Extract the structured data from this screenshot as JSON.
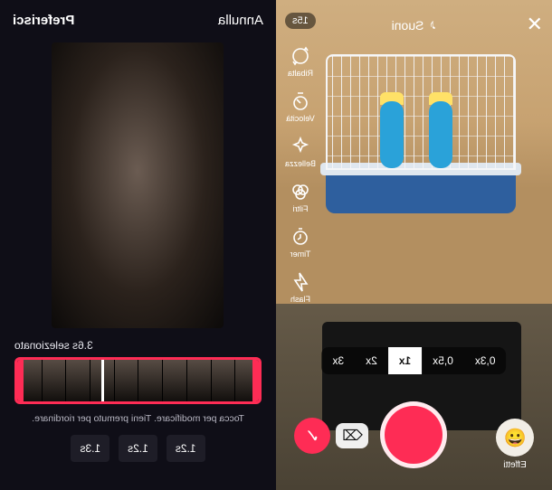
{
  "camera": {
    "close": "✕",
    "sounds_label": "Suoni",
    "duration_label": "15s",
    "side_tools": [
      {
        "id": "flip",
        "label": "Ribalta"
      },
      {
        "id": "speed",
        "label": "Velocità"
      },
      {
        "id": "beauty",
        "label": "Bellezza"
      },
      {
        "id": "filters",
        "label": "Filtri"
      },
      {
        "id": "timer",
        "label": "Timer"
      },
      {
        "id": "flash",
        "label": "Flash"
      }
    ],
    "speeds": [
      "0,3x",
      "0,5x",
      "1x",
      "2x",
      "3x"
    ],
    "speed_selected": "1x",
    "effects_label": "Effetti",
    "effects_emoji": "😀",
    "delete_glyph": "⌫",
    "next_glyph": "✓"
  },
  "trim": {
    "cancel": "Annulla",
    "done": "Preferisci",
    "selection_label": "3.6s selezionato",
    "hint": "Tocca per modificare. Tieni premuto per riordinare.",
    "thumb_count": 10,
    "quick_durations": [
      "1.2s",
      "1.2s",
      "1.3s"
    ]
  }
}
